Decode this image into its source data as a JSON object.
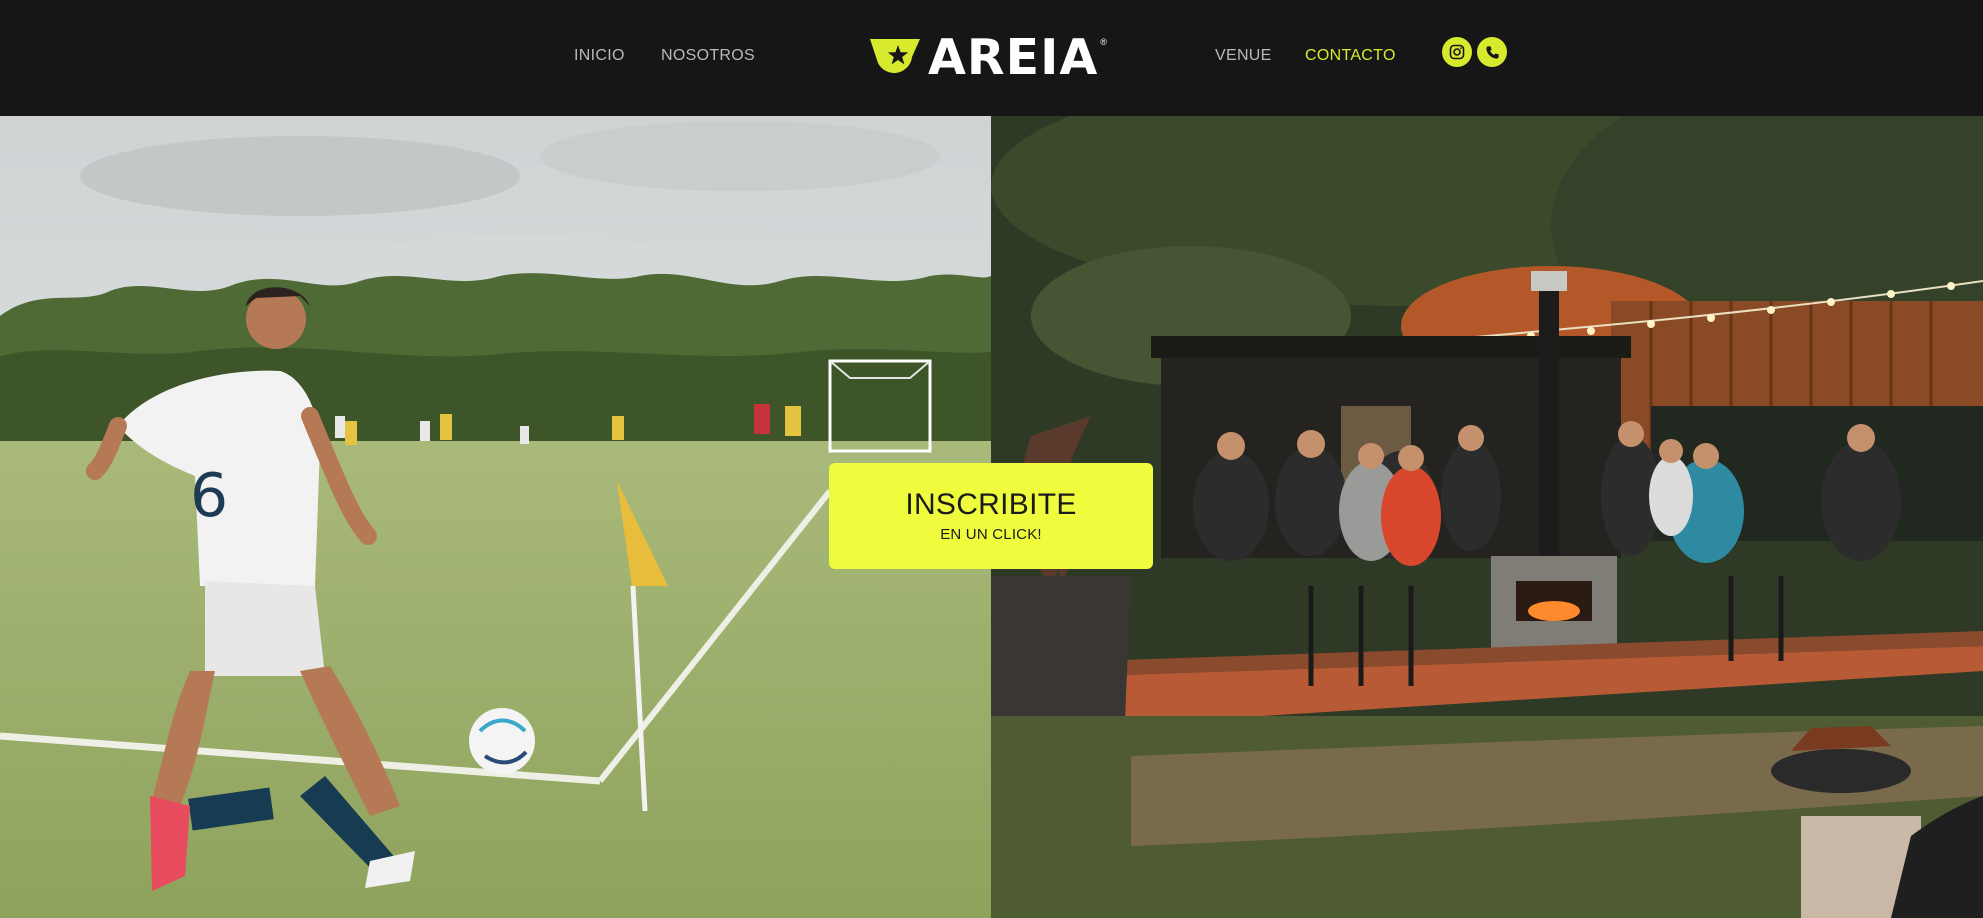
{
  "nav": {
    "inicio": "INICIO",
    "nosotros": "NOSOTROS",
    "venue": "VENUE",
    "contacto": "CONTACTO"
  },
  "logo": {
    "text": "AREIA",
    "reg": "®"
  },
  "social": {
    "instagram_icon": "instagram-icon",
    "phone_icon": "phone-icon"
  },
  "cta": {
    "title": "INSCRIBITE",
    "subtitle": "EN UN CLICK!"
  },
  "photos": {
    "left": "football-corner-kick-photo",
    "right": "outdoor-venue-terrace-photo"
  },
  "colors": {
    "accent": "#d7ea2e",
    "cta_bg": "#eefc3d",
    "header_bg": "#161616",
    "nav_text": "#b9b9b9"
  }
}
